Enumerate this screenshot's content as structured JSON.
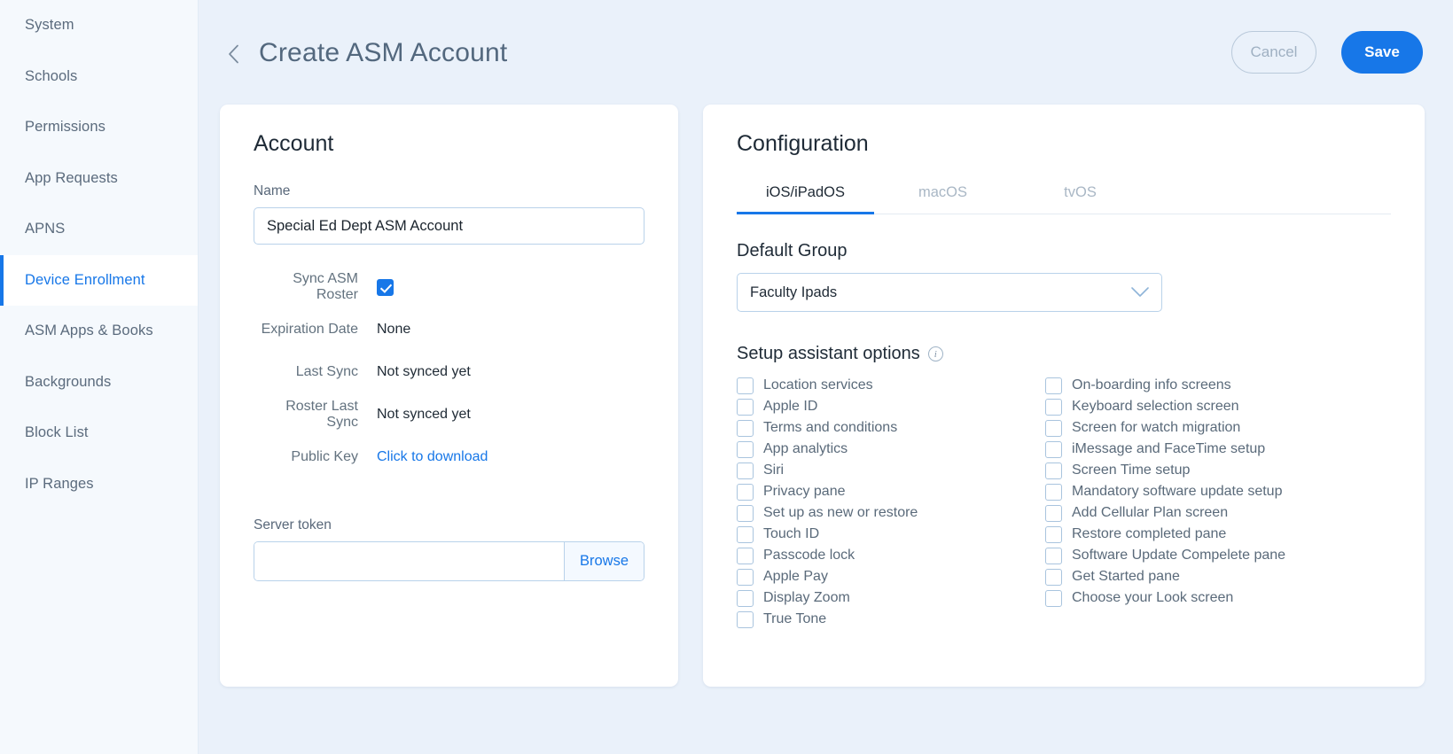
{
  "sidebar": {
    "items": [
      {
        "label": "System",
        "active": false
      },
      {
        "label": "Schools",
        "active": false
      },
      {
        "label": "Permissions",
        "active": false
      },
      {
        "label": "App Requests",
        "active": false
      },
      {
        "label": "APNS",
        "active": false
      },
      {
        "label": "Device Enrollment",
        "active": true
      },
      {
        "label": "ASM Apps & Books",
        "active": false
      },
      {
        "label": "Backgrounds",
        "active": false
      },
      {
        "label": "Block List",
        "active": false
      },
      {
        "label": "IP Ranges",
        "active": false
      }
    ]
  },
  "header": {
    "title": "Create ASM Account",
    "back_icon": "chevron-left-icon",
    "cancel_label": "Cancel",
    "save_label": "Save"
  },
  "account": {
    "title": "Account",
    "name_label": "Name",
    "name_value": "Special Ed Dept ASM Account",
    "name_placeholder": "",
    "rows": [
      {
        "label": "Sync ASM Roster",
        "type": "checkbox",
        "checked": true
      },
      {
        "label": "Expiration Date",
        "type": "text",
        "value": "None"
      },
      {
        "label": "Last Sync",
        "type": "text",
        "value": "Not synced yet"
      },
      {
        "label": "Roster Last Sync",
        "type": "text",
        "value": "Not synced yet"
      },
      {
        "label": "Public Key",
        "type": "link",
        "value": "Click to download"
      }
    ],
    "server_token_label": "Server token",
    "server_token_value": "",
    "server_token_placeholder": "",
    "browse_label": "Browse"
  },
  "configuration": {
    "title": "Configuration",
    "tabs": [
      {
        "label": "iOS/iPadOS",
        "active": true
      },
      {
        "label": "macOS",
        "active": false
      },
      {
        "label": "tvOS",
        "active": false
      }
    ],
    "default_group_label": "Default Group",
    "default_group_value": "Faculty Ipads",
    "setup_options_label": "Setup assistant options",
    "setup_options_info_icon": "info-icon",
    "options_left": [
      {
        "label": "Location services",
        "checked": false
      },
      {
        "label": "Apple ID",
        "checked": false
      },
      {
        "label": "Terms and conditions",
        "checked": false
      },
      {
        "label": "App analytics",
        "checked": false
      },
      {
        "label": "Siri",
        "checked": false
      },
      {
        "label": "Privacy pane",
        "checked": false
      },
      {
        "label": "Set up as new or restore",
        "checked": false
      },
      {
        "label": "Touch ID",
        "checked": false
      },
      {
        "label": "Passcode lock",
        "checked": false
      },
      {
        "label": "Apple Pay",
        "checked": false
      },
      {
        "label": "Display Zoom",
        "checked": false
      },
      {
        "label": "True Tone",
        "checked": false
      }
    ],
    "options_right": [
      {
        "label": "On-boarding info screens",
        "checked": false
      },
      {
        "label": "Keyboard selection screen",
        "checked": false
      },
      {
        "label": "Screen for watch migration",
        "checked": false
      },
      {
        "label": "iMessage and FaceTime setup",
        "checked": false
      },
      {
        "label": "Screen Time setup",
        "checked": false
      },
      {
        "label": "Mandatory software update setup",
        "checked": false
      },
      {
        "label": "Add Cellular Plan screen",
        "checked": false
      },
      {
        "label": "Restore completed pane",
        "checked": false
      },
      {
        "label": "Software Update Compelete pane",
        "checked": false
      },
      {
        "label": "Get Started pane",
        "checked": false
      },
      {
        "label": "Choose your Look screen",
        "checked": false
      }
    ]
  },
  "colors": {
    "accent": "#1777e8",
    "page_bg": "#eaf1fa",
    "sidebar_bg": "#f5f9fd",
    "card_bg": "#ffffff",
    "muted_text": "#5a6a7a"
  }
}
